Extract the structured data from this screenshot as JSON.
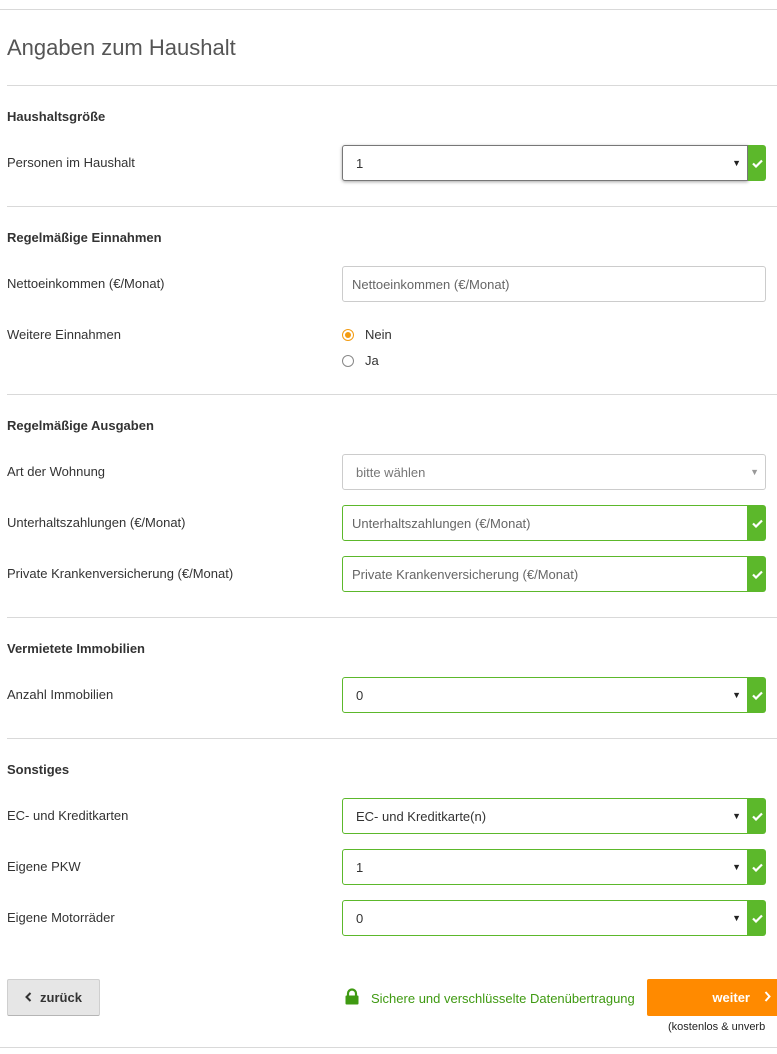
{
  "page_title": "Angaben zum Haushalt",
  "sections": {
    "haushalt": {
      "title": "Haushaltsgröße",
      "personen": {
        "label": "Personen im Haushalt",
        "value": "1"
      }
    },
    "einnahmen": {
      "title": "Regelmäßige Einnahmen",
      "netto": {
        "label": "Nettoeinkommen (€/Monat)",
        "placeholder": "Nettoeinkommen (€/Monat)"
      },
      "weitere": {
        "label": "Weitere Einnahmen",
        "options": [
          "Nein",
          "Ja"
        ],
        "selected": "Nein"
      }
    },
    "ausgaben": {
      "title": "Regelmäßige Ausgaben",
      "wohnung": {
        "label": "Art der Wohnung",
        "value": "bitte wählen"
      },
      "unterhalt": {
        "label": "Unterhaltszahlungen (€/Monat)",
        "placeholder": "Unterhaltszahlungen (€/Monat)"
      },
      "pkv": {
        "label": "Private Krankenversicherung (€/Monat)",
        "placeholder": "Private Krankenversicherung (€/Monat)"
      }
    },
    "immobilien": {
      "title": "Vermietete Immobilien",
      "anzahl": {
        "label": "Anzahl Immobilien",
        "value": "0"
      }
    },
    "sonstiges": {
      "title": "Sonstiges",
      "karten": {
        "label": "EC- und Kreditkarten",
        "value": "EC- und Kreditkarte(n)"
      },
      "pkw": {
        "label": "Eigene PKW",
        "value": "1"
      },
      "motorrad": {
        "label": "Eigene Motorräder",
        "value": "0"
      }
    }
  },
  "footer": {
    "back_label": "zurück",
    "secure_text": "Sichere und verschlüsselte Datenübertragung",
    "next_label": "weiter",
    "note": "(kostenlos & unverb"
  },
  "colors": {
    "accent": "#ff8a00",
    "valid": "#5cb82b",
    "secure": "#3f9a12",
    "radio": "#f39c12"
  },
  "icons": {
    "valid": "check-icon",
    "select": "caret-down-icon",
    "back": "chevron-left-icon",
    "next": "chevron-right-icon",
    "secure": "lock-icon"
  }
}
